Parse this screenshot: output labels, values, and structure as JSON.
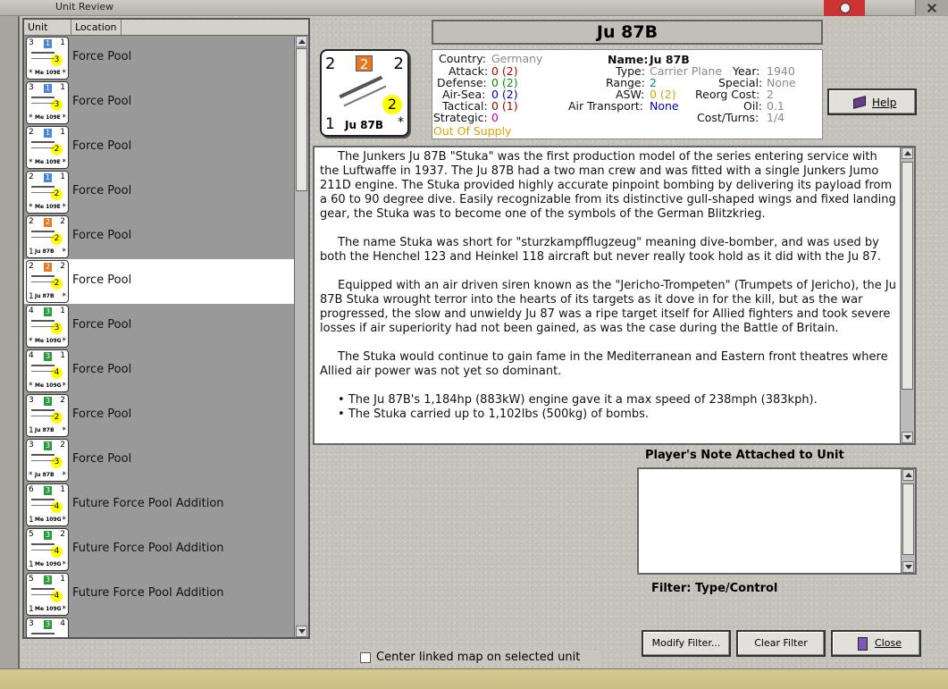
{
  "window": {
    "title": "Unit Review"
  },
  "list": {
    "headers": {
      "unit": "Unit",
      "location": "Location"
    },
    "rows": [
      {
        "att": "3",
        "type": "1",
        "type_color": "#4a86d6",
        "rng": "1",
        "mv": "3",
        "def": "*",
        "name": "Me 109E",
        "star": "*",
        "location": "Force Pool"
      },
      {
        "att": "3",
        "type": "1",
        "type_color": "#4a86d6",
        "rng": "1",
        "mv": "3",
        "def": "*",
        "name": "Me 109E",
        "star": "*",
        "location": "Force Pool"
      },
      {
        "att": "2",
        "type": "1",
        "type_color": "#4a86d6",
        "rng": "1",
        "mv": "2",
        "def": "*",
        "name": "Me 109E",
        "star": "*",
        "location": "Force Pool"
      },
      {
        "att": "2",
        "type": "1",
        "type_color": "#4a86d6",
        "rng": "1",
        "mv": "2",
        "def": "*",
        "name": "Me 109E",
        "star": "*",
        "location": "Force Pool"
      },
      {
        "att": "2",
        "type": "2",
        "type_color": "#e8771f",
        "rng": "2",
        "mv": "2",
        "def": "1",
        "name": "Ju 87B",
        "star": "*",
        "location": "Force Pool"
      },
      {
        "att": "2",
        "type": "2",
        "type_color": "#e8771f",
        "rng": "2",
        "mv": "2",
        "def": "1",
        "name": "Ju 87B",
        "star": "*",
        "location": "Force Pool",
        "selected": true
      },
      {
        "att": "4",
        "type": "3",
        "type_color": "#2a9a3a",
        "rng": "1",
        "mv": "3",
        "def": "*",
        "name": "Me 109G",
        "star": "*",
        "location": "Force Pool"
      },
      {
        "att": "4",
        "type": "3",
        "type_color": "#2a9a3a",
        "rng": "1",
        "mv": "4",
        "def": "*",
        "name": "Me 109G",
        "star": "*",
        "location": "Force Pool"
      },
      {
        "att": "3",
        "type": "3",
        "type_color": "#2a9a3a",
        "rng": "2",
        "mv": "2",
        "def": "1",
        "name": "Ju 87B",
        "star": "*",
        "location": "Force Pool"
      },
      {
        "att": "3",
        "type": "3",
        "type_color": "#2a9a3a",
        "rng": "2",
        "mv": "3",
        "def": "*",
        "name": "Ju 87B",
        "star": "*",
        "location": "Force Pool"
      },
      {
        "att": "6",
        "type": "3",
        "type_color": "#2a9a3a",
        "rng": "1",
        "mv": "4",
        "def": "1",
        "name": "Me 109G",
        "star": "*",
        "location": "Future Force Pool Addition"
      },
      {
        "att": "5",
        "type": "3",
        "type_color": "#2a9a3a",
        "rng": "2",
        "mv": "4",
        "def": "1",
        "name": "Me 109G",
        "star": "*",
        "location": "Future Force Pool Addition"
      },
      {
        "att": "5",
        "type": "3",
        "type_color": "#2a9a3a",
        "rng": "1",
        "mv": "4",
        "def": "1",
        "name": "Me 109G",
        "star": "*",
        "location": "Future Force Pool Addition"
      },
      {
        "att": "3",
        "type": "3",
        "type_color": "#2a9a3a",
        "rng": "4",
        "mv": "",
        "def": "",
        "name": "",
        "star": "",
        "location": ""
      }
    ]
  },
  "unit": {
    "title": "Ju 87B",
    "counter": {
      "att": "2",
      "type": "2",
      "rng": "2",
      "mv": "2",
      "def": "1",
      "name": "Ju 87B",
      "star": "*"
    },
    "stats": {
      "country_k": "Country:",
      "country_v": "Germany",
      "attack_k": "Attack:",
      "attack_v": "0 (2)",
      "defense_k": "Defense:",
      "defense_v": "0 (2)",
      "airsea_k": "Air-Sea:",
      "airsea_v": "0 (2)",
      "tactical_k": "Tactical:",
      "tactical_v": "0 (1)",
      "strategic_k": "Strategic:",
      "strategic_v": "0",
      "supply": "Out Of Supply",
      "name_k": "Name:",
      "name_v": "Ju 87B",
      "type_k": "Type:",
      "type_v": "Carrier Plane",
      "range_k": "Range:",
      "range_v": "2",
      "asw_k": "ASW:",
      "asw_v": "0 (2)",
      "airtransport_k": "Air Transport:",
      "airtransport_v": "None",
      "year_k": "Year:",
      "year_v": "1940",
      "special_k": "Special:",
      "special_v": "None",
      "reorg_k": "Reorg Cost:",
      "reorg_v": "2",
      "oil_k": "Oil:",
      "oil_v": "0.1",
      "costturns_k": "Cost/Turns:",
      "costturns_v": "1/4"
    }
  },
  "description": {
    "p1": "The Junkers Ju 87B \"Stuka\" was the first production model of the series entering service with the Luftwaffe in 1937.  The Ju 87B had a two man crew and was fitted with a single Junkers Jumo 211D engine.  The Stuka provided highly accurate pinpoint bombing by delivering its payload from a 60 to 90 degree dive.  Easily recognizable from its distinctive gull-shaped wings and fixed landing gear, the Stuka was to become one of the symbols of the German Blitzkrieg.",
    "p2": "The name Stuka was short for \"sturzkampfflugzeug\" meaning dive-bomber, and was used by both the Henchel 123 and Heinkel 118 aircraft but never really took hold as it did with the Ju 87.",
    "p3": "Equipped with an air driven siren known as the \"Jericho-Trompeten\" (Trumpets of Jericho), the Ju 87B Stuka wrought terror into the hearts of its targets as it dove in for the kill, but as the war progressed, the slow and unwieldy Ju 87 was a ripe target itself for Allied fighters and took severe losses if air superiority had not been gained, as was the case during the Battle of Britain.",
    "p4": "The Stuka would continue to gain fame in the Mediterranean and Eastern front theatres where Allied air power was not yet so dominant.",
    "b1": "The Ju 87B's 1,184hp (883kW) engine gave it a max speed of 238mph (383kph).",
    "b2": "The Stuka carried up to 1,102lbs (500kg) of bombs."
  },
  "note": {
    "label": "Player's Note Attached to Unit"
  },
  "filter": {
    "label": "Filter:  Type/Control"
  },
  "buttons": {
    "help": "Help",
    "modify": "Modify Filter...",
    "clear": "Clear Filter",
    "close": "Close"
  },
  "center_linked": {
    "label": "Center linked map on selected unit",
    "checked": false
  }
}
